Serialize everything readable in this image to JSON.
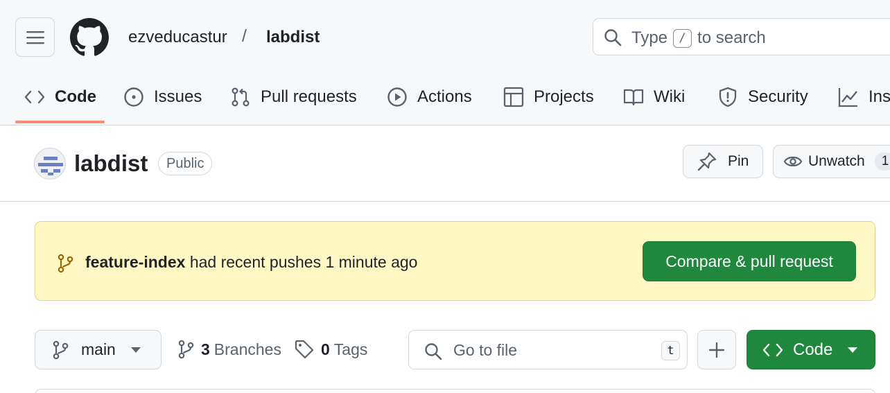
{
  "header": {
    "owner": "ezveducastur",
    "separator": "/",
    "repo": "labdist",
    "search": {
      "prefix": "Type",
      "key": "/",
      "suffix": "to search"
    }
  },
  "tabs": [
    {
      "label": "Code",
      "icon": "code-icon",
      "selected": true
    },
    {
      "label": "Issues",
      "icon": "issue-opened-icon"
    },
    {
      "label": "Pull requests",
      "icon": "git-pull-request-icon"
    },
    {
      "label": "Actions",
      "icon": "play-icon"
    },
    {
      "label": "Projects",
      "icon": "table-icon"
    },
    {
      "label": "Wiki",
      "icon": "book-icon"
    },
    {
      "label": "Security",
      "icon": "shield-icon"
    },
    {
      "label": "Ins",
      "icon": "graph-icon"
    }
  ],
  "repo_header": {
    "name": "labdist",
    "visibility": "Public",
    "pin_label": "Pin",
    "watch_label": "Unwatch",
    "watch_count": "1"
  },
  "banner": {
    "branch": "feature-index",
    "message": " had recent pushes 1 minute ago",
    "button": "Compare & pull request"
  },
  "toolbar": {
    "branch": "main",
    "branches_count": "3",
    "branches_label": "Branches",
    "tags_count": "0",
    "tags_label": "Tags",
    "go_to_file_placeholder": "Go to file",
    "go_to_file_key": "t",
    "code_button": "Code"
  },
  "colors": {
    "accent_green": "#1f883d",
    "tab_underline": "#fd8c73",
    "banner_bg": "#fff8c5"
  }
}
